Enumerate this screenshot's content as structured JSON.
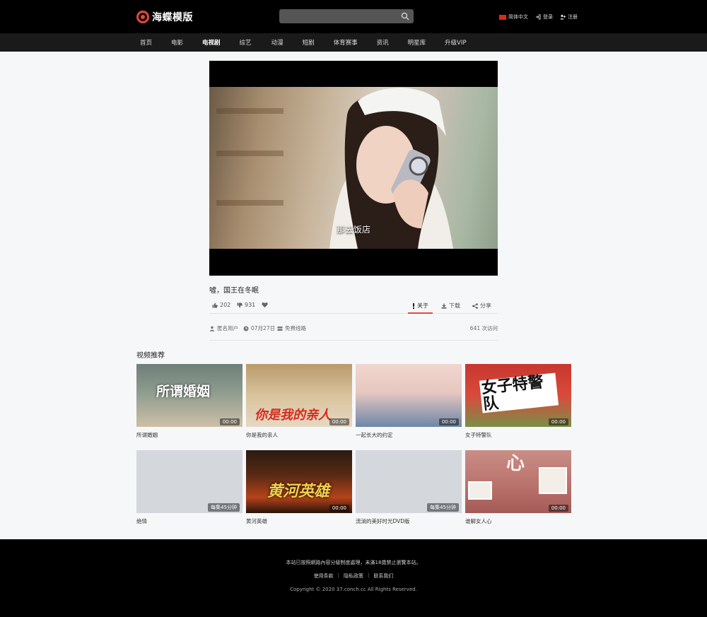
{
  "header": {
    "logo_text": "海蝶模版",
    "search_placeholder": "",
    "language_label": "简体中文",
    "login_label": "登录",
    "register_label": "注册"
  },
  "nav": {
    "items": [
      "首页",
      "电影",
      "电视剧",
      "综艺",
      "动漫",
      "短剧",
      "体育赛事",
      "资讯",
      "明星库",
      "升级VIP"
    ],
    "active_index": 2
  },
  "player": {
    "subtitle": "那去饭店"
  },
  "video": {
    "title": "噓，国王在冬眠",
    "likes": "202",
    "dislikes": "931",
    "about_label": "关于",
    "download_label": "下载",
    "share_label": "分享",
    "uploader": "匿名用户",
    "date": "07月27日",
    "route": "免费线路",
    "views": "641 次访问"
  },
  "recommend": {
    "title": "视频推荐",
    "items": [
      {
        "title": "所谓婚姻",
        "badge": "00:00",
        "poster_text": "所谓婚姻"
      },
      {
        "title": "你是我的亲人",
        "badge": "00:00",
        "poster_text": "你是我的亲人"
      },
      {
        "title": "一起长大的约定",
        "badge": "00:00",
        "poster_text": ""
      },
      {
        "title": "女子特警队",
        "badge": "00:00",
        "poster_text": "女子特警队"
      },
      {
        "title": "绝情",
        "badge": "每集45分钟",
        "poster_text": ""
      },
      {
        "title": "黄河英雄",
        "badge": "00:00",
        "poster_text": "黄河英雄"
      },
      {
        "title": "流淌的美好时光DVD版",
        "badge": "每集45分钟",
        "poster_text": ""
      },
      {
        "title": "谁解女人心",
        "badge": "00:00",
        "poster_text": "心"
      }
    ]
  },
  "footer": {
    "notice": "本站已按照網路內容分級制度處理，未滿18歲禁止瀏覽本站。",
    "links": [
      "使用条款",
      "隐私政策",
      "联系我们"
    ],
    "copyright": "Copyright © 2020 37.conch.cc All Rights Reserved."
  },
  "colors": {
    "accent": "#e8483a",
    "header_bg": "#000000",
    "nav_bg": "#1a1a1a",
    "page_bg": "#f6f7f9"
  }
}
